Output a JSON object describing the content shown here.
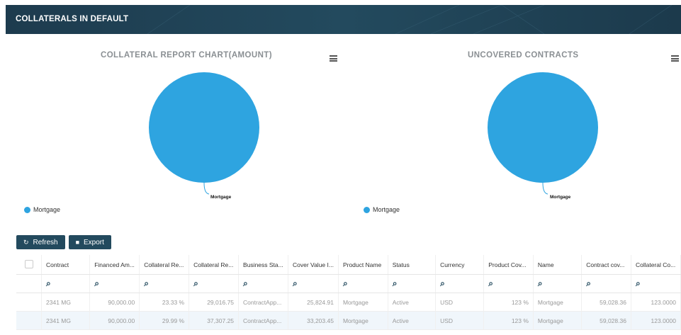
{
  "header": {
    "title": "COLLATERALS IN DEFAULT"
  },
  "colors": {
    "accent": "#2ea4e0",
    "header_bg": "#1d3b4e",
    "button_bg": "#234a5e"
  },
  "charts": [
    {
      "title": "COLLATERAL REPORT CHART(AMOUNT)",
      "slice_label": "Mortgage",
      "legend": "Mortgage",
      "menu_icon": "hamburger-icon"
    },
    {
      "title": "UNCOVERED CONTRACTS",
      "slice_label": "Mortgage",
      "legend": "Mortgage",
      "menu_icon": "hamburger-icon"
    }
  ],
  "chart_data": [
    {
      "type": "pie",
      "title": "COLLATERAL REPORT CHART(AMOUNT)",
      "categories": [
        "Mortgage"
      ],
      "values": [
        100
      ],
      "legend_position": "bottom-left"
    },
    {
      "type": "pie",
      "title": "UNCOVERED CONTRACTS",
      "categories": [
        "Mortgage"
      ],
      "values": [
        100
      ],
      "legend_position": "bottom-left"
    }
  ],
  "toolbar": {
    "refresh_label": "Refresh",
    "refresh_icon": "refresh-icon",
    "export_label": "Export",
    "export_icon": "file-icon"
  },
  "table": {
    "columns": [
      "Contract",
      "Financed Am...",
      "Collateral Re...",
      "Collateral Re...",
      "Business Sta...",
      "Cover Value I...",
      "Product Name",
      "Status",
      "Currency",
      "Product Cov...",
      "Name",
      "Contract cov...",
      "Collateral Co..."
    ],
    "rows": [
      [
        "2341 MG",
        "90,000.00",
        "23.33 %",
        "29,016.75",
        "ContractApp...",
        "25,824.91",
        "Mortgage",
        "Active",
        "USD",
        "123 %",
        "Mortgage",
        "59,028.36",
        "123.0000"
      ],
      [
        "2341 MG",
        "90,000.00",
        "29.99 %",
        "37,307.25",
        "ContractApp...",
        "33,203.45",
        "Mortgage",
        "Active",
        "USD",
        "123 %",
        "Mortgage",
        "59,028.36",
        "123.0000"
      ]
    ]
  }
}
